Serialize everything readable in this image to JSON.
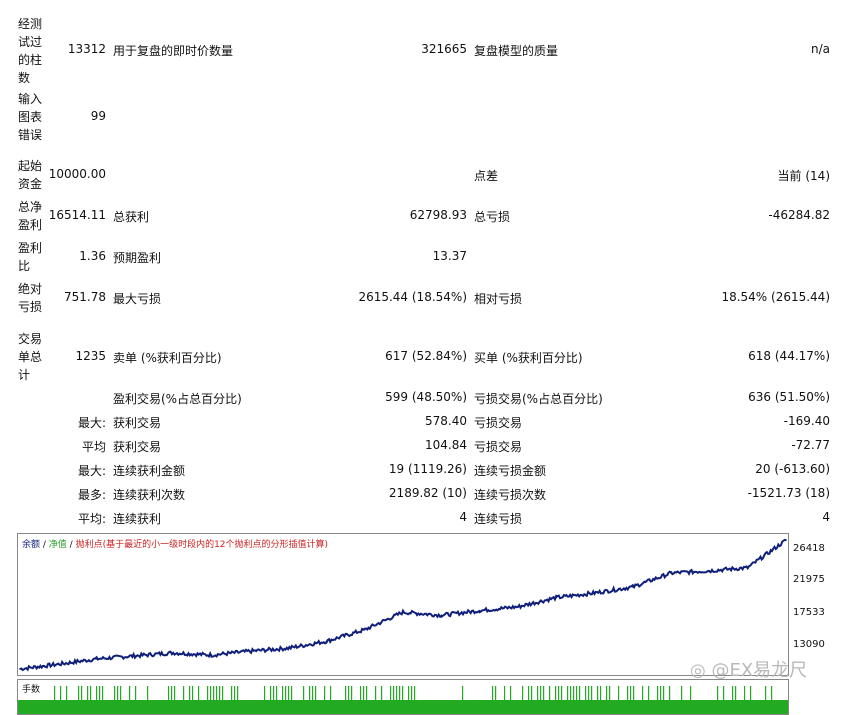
{
  "report": {
    "bars_tested_label": "经测试过的柱数",
    "bars_tested_value": "13312",
    "ticks_label": "用于复盘的即时价数量",
    "ticks_value": "321665",
    "model_quality_label": "复盘模型的质量",
    "model_quality_value": "n/a",
    "chart_errors_label": "输入图表错误",
    "chart_errors_value": "99",
    "initial_deposit_label": "起始资金",
    "initial_deposit_value": "10000.00",
    "spread_label": "点差",
    "spread_value": "当前 (14)",
    "net_profit_label": "总净盈利",
    "net_profit_value": "16514.11",
    "gross_profit_label": "总获利",
    "gross_profit_value": "62798.93",
    "gross_loss_label": "总亏损",
    "gross_loss_value": "-46284.82",
    "profit_factor_label": "盈利比",
    "profit_factor_value": "1.36",
    "expected_payoff_label": "预期盈利",
    "expected_payoff_value": "13.37",
    "abs_drawdown_label": "绝对亏损",
    "abs_drawdown_value": "751.78",
    "max_drawdown_label": "最大亏损",
    "max_drawdown_value": "2615.44 (18.54%)",
    "rel_drawdown_label": "相对亏损",
    "rel_drawdown_value": "18.54% (2615.44)",
    "total_trades_label": "交易单总计",
    "total_trades_value": "1235",
    "short_label": "卖单 (%获利百分比)",
    "short_value": "617 (52.84%)",
    "long_label": "买单 (%获利百分比)",
    "long_value": "618 (44.17%)",
    "profit_trades_label": "盈利交易(%占总百分比)",
    "profit_trades_value": "599 (48.50%)",
    "loss_trades_label": "亏损交易(%占总百分比)",
    "loss_trades_value": "636 (51.50%)",
    "rows": [
      {
        "prefix": "最大:",
        "left_label": "获利交易",
        "left_value": "578.40",
        "right_label": "亏损交易",
        "right_value": "-169.40"
      },
      {
        "prefix": "平均",
        "left_label": "获利交易",
        "left_value": "104.84",
        "right_label": "亏损交易",
        "right_value": "-72.77"
      },
      {
        "prefix": "最大:",
        "left_label": "连续获利金额",
        "left_value": "19 (1119.26)",
        "right_label": "连续亏损金额",
        "right_value": "20 (-613.60)"
      },
      {
        "prefix": "最多:",
        "left_label": "连续获利次数",
        "left_value": "2189.82 (10)",
        "right_label": "连续亏损次数",
        "right_value": "-1521.73 (18)"
      },
      {
        "prefix": "平均:",
        "left_label": "连续获利",
        "left_value": "4",
        "right_label": "连续亏损",
        "right_value": "4"
      }
    ]
  },
  "chart": {
    "legend_balance": "余额",
    "legend_sep1": " / ",
    "legend_equity": "净值",
    "legend_sep2": " / ",
    "legend_points": "抛利点(基于最近的小一级时段内的12个抛利点的分形插值计算)",
    "volume_label": "手数",
    "colors": {
      "balance": "#0f1f7a",
      "equity": "#2aa02a",
      "points": "#cc2222",
      "volume": "#22aa22"
    }
  },
  "chart_data": {
    "type": "line",
    "series": [
      {
        "name": "余额",
        "x": [
          0,
          5,
          10,
          15,
          20,
          25,
          30,
          35,
          40,
          45,
          50,
          55,
          60,
          65,
          70,
          75,
          80,
          85,
          90,
          95,
          100
        ],
        "values": [
          9600,
          10200,
          10900,
          11300,
          11700,
          11400,
          11900,
          12300,
          13200,
          14700,
          17000,
          16600,
          17200,
          17700,
          18900,
          19500,
          20300,
          22100,
          22400,
          22800,
          26400
        ]
      }
    ],
    "ylim": [
      8800,
      27200
    ],
    "yticks": [
      "26418",
      "21975",
      "17533",
      "13090"
    ]
  },
  "watermark": "@EX易龙尺",
  "watermark_icon": "weibo-icon"
}
